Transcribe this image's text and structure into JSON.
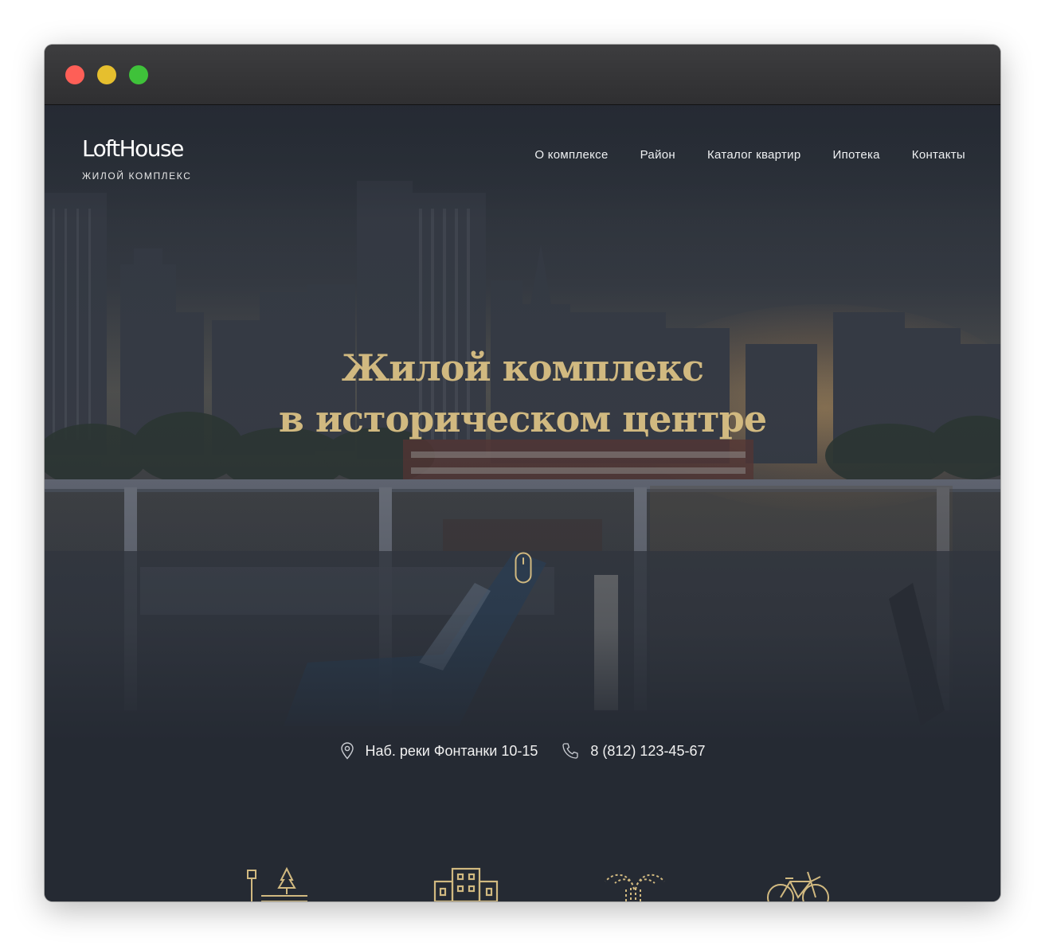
{
  "window": {
    "controls": [
      "close",
      "minimize",
      "maximize"
    ]
  },
  "header": {
    "logo_title": "LoftHouse",
    "logo_subtitle": "ЖИЛОЙ КОМПЛЕКС",
    "nav": [
      {
        "label": "О комплексе"
      },
      {
        "label": "Район"
      },
      {
        "label": "Каталог квартир"
      },
      {
        "label": "Ипотека"
      },
      {
        "label": "Контакты"
      }
    ]
  },
  "hero": {
    "headline_line1": "Жилой комплекс",
    "headline_line2": "в историческом центре",
    "scroll_icon": "mouse-scroll-icon",
    "background": "city-rooftop-photo"
  },
  "contacts": {
    "address": "Наб. реки Фонтанки 10-15",
    "address_icon": "map-pin-icon",
    "phone": "8 (812) 123-45-67",
    "phone_icon": "phone-icon"
  },
  "features": {
    "icons": [
      "park-icon",
      "building-icon",
      "fountain-icon",
      "bicycle-icon"
    ]
  },
  "colors": {
    "background": "#252a33",
    "accent_gold": "#d1b980",
    "text_light": "#ffffff",
    "close": "#fe5f57",
    "minimize": "#e6bf2e",
    "maximize": "#3fc23a"
  }
}
